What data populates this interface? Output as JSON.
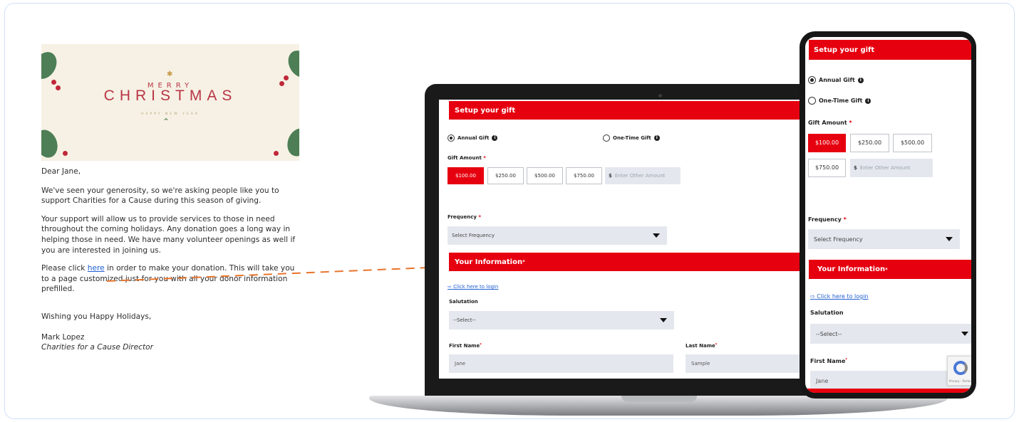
{
  "email": {
    "banner": {
      "merry": "MERRY",
      "christmas": "CHRISTMAS",
      "new_year": "HAPPY NEW YEAR"
    },
    "greeting": "Dear Jane,",
    "p1": "We've seen your generosity, so we're asking people like you to support Charities for a Cause during this season of giving.",
    "p2": "Your support will allow us to provide services to those in need throughout the coming holidays. Any donation goes a long way in helping those in need. We have many volunteer openings as well if you are interested in joining us.",
    "p3_before": "Please click ",
    "p3_link": "here",
    "p3_after": " in order to make your donation. This will take you to a page customized just for you with all your donor information prefilled.",
    "closing": "Wishing you Happy Holidays,",
    "sender_name": "Mark Lopez",
    "sender_title": "Charities for a Cause Director"
  },
  "form": {
    "setup_title": "Setup your gift",
    "annual_gift": "Annual Gift",
    "one_time_gift": "One-Time Gift",
    "selected_gift_type": "Annual Gift",
    "gift_amount_label": "Gift Amount",
    "amounts": [
      "$100.00",
      "$250.00",
      "$500.00",
      "$750.00"
    ],
    "selected_amount": "$100.00",
    "currency_symbol": "$",
    "other_amount_placeholder": "Enter Other Amount",
    "frequency_label": "Frequency",
    "frequency_value": "Select Frequency",
    "your_information_title": "Your Information",
    "login_link": "Click here to login",
    "salutation_label": "Salutation",
    "salutation_value": "--Select--",
    "first_name_label": "First Name",
    "first_name_value": "Jane",
    "last_name_label": "Last Name",
    "last_name_value": "Sample",
    "required_marker": "*",
    "recaptcha_text": "Privacy - Terms"
  },
  "colors": {
    "accent": "#e6000f",
    "link": "#1f5fd1",
    "connector": "#e8742b"
  },
  "icons": {
    "info": "info-icon",
    "caret": "chevron-down-icon",
    "login": "login-icon"
  }
}
